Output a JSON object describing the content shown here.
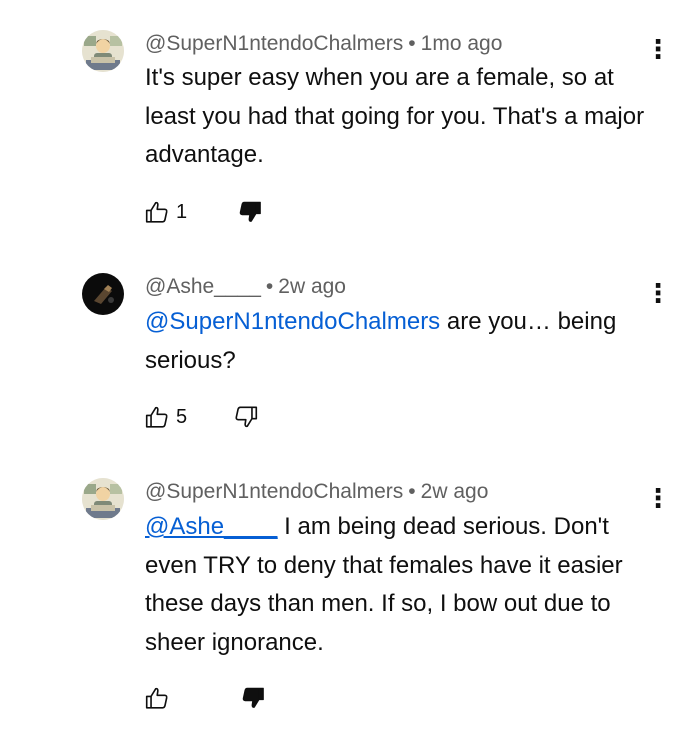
{
  "comments": [
    {
      "author": "@SuperN1ntendoChalmers",
      "separator": "•",
      "time": "1mo ago",
      "text": "It's super easy when you are a female, so at least you had that going for you.  That's a major advantage.",
      "likes": "1",
      "disliked": true,
      "avatar_icon": "cartoon-avatar-icon"
    },
    {
      "author": "@Ashe____",
      "separator": "•",
      "time": "2w ago",
      "mention": "@SuperN1ntendoChalmers",
      "text": " are you… being serious?",
      "likes": "5",
      "disliked": false,
      "avatar_icon": "dark-avatar-icon"
    },
    {
      "author": "@SuperN1ntendoChalmers",
      "separator": "•",
      "time": "2w ago",
      "mention": "@Ashe____",
      "text": " I am being dead serious.  Don't even TRY to deny that females have it easier these days than men.  If so, I bow out due to sheer ignorance.",
      "likes": "",
      "disliked": true,
      "avatar_icon": "cartoon-avatar-icon"
    }
  ],
  "icons": {
    "more": "⋮",
    "like": "thumb-up-outline-icon",
    "dislike": "thumb-down-icon"
  },
  "colors": {
    "mention": "#065fd4",
    "meta": "#606060",
    "text": "#0f0f0f"
  }
}
